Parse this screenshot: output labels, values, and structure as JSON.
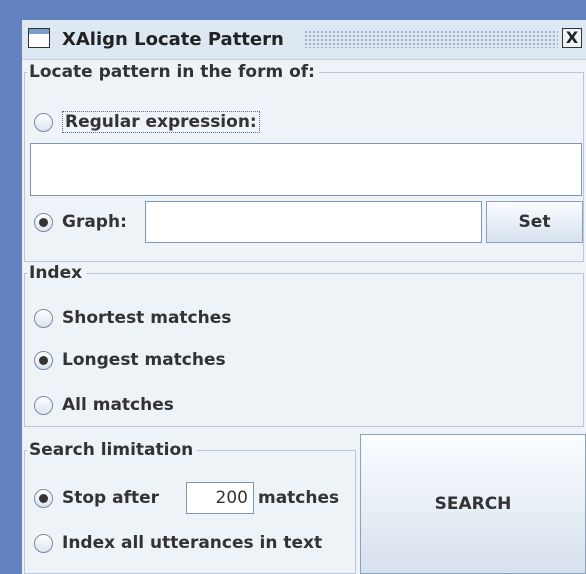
{
  "window": {
    "title": "XAlign Locate Pattern",
    "close_glyph": "X"
  },
  "pattern": {
    "legend": "Locate pattern in the form of:",
    "regex_label": "Regular expression:",
    "regex_selected": false,
    "regex_value": "",
    "graph_label": "Graph:",
    "graph_selected": true,
    "graph_value": "",
    "set_label": "Set"
  },
  "index": {
    "legend": "Index",
    "options": [
      {
        "label": "Shortest matches",
        "selected": false
      },
      {
        "label": "Longest matches",
        "selected": true
      },
      {
        "label": "All matches",
        "selected": false
      }
    ]
  },
  "limitation": {
    "legend": "Search limitation",
    "stop_prefix": "Stop after",
    "stop_value": "200",
    "stop_suffix": "matches",
    "stop_selected": true,
    "all_label": "Index all utterances in text",
    "all_selected": false
  },
  "search_label": "SEARCH"
}
